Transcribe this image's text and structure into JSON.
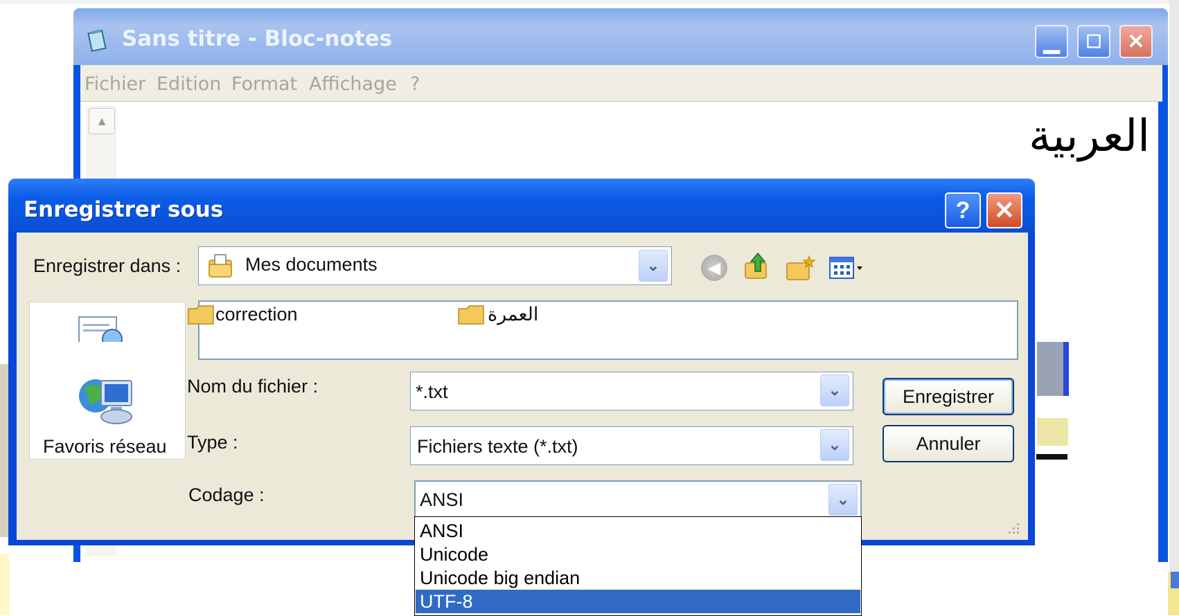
{
  "notepad": {
    "title": "Sans titre - Bloc-notes",
    "menu": [
      "Fichier",
      "Edition",
      "Format",
      "Affichage",
      "?"
    ],
    "content": "العربية",
    "controls": {
      "minimize": "_",
      "maximize": "□",
      "close": "✕"
    }
  },
  "dialog": {
    "title": "Enregistrer sous",
    "help_label": "?",
    "close_label": "✕",
    "save_in_label": "Enregistrer dans :",
    "save_in_value": "Mes documents",
    "places": {
      "network": "Favoris réseau"
    },
    "files": [
      "correction",
      "العمرة"
    ],
    "filename_label": "Nom du fichier :",
    "filename_value": "*.txt",
    "type_label": "Type :",
    "type_value": "Fichiers texte (*.txt)",
    "encoding_label": "Codage :",
    "encoding_value": "ANSI",
    "encoding_options": [
      "ANSI",
      "Unicode",
      "Unicode big endian",
      "UTF-8"
    ],
    "encoding_highlighted": "UTF-8",
    "save_button": "Enregistrer",
    "cancel_button": "Annuler"
  },
  "colors": {
    "xp_blue": "#0a54e2",
    "dialog_bg": "#ece9d8",
    "selection": "#316ac5"
  }
}
